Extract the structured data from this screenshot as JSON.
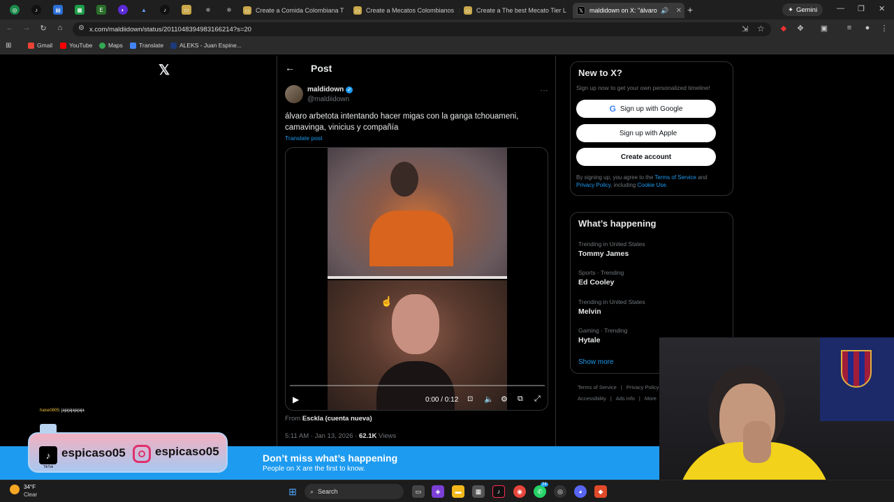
{
  "browser": {
    "tabs": [
      {
        "label": "Create a Comida Colombiana T"
      },
      {
        "label": "Create a Mecatos Colombianos"
      },
      {
        "label": "Create a The best Mecato Tier L"
      },
      {
        "label": "maldidown on X: \"álvaro ar"
      }
    ],
    "gemini_label": "Gemini",
    "url": "x.com/maldiidown/status/2011048394983166214?s=20",
    "bookmarks": [
      "Gmail",
      "YouTube",
      "Maps",
      "Translate",
      "ALEKS - Juan Espine..."
    ]
  },
  "header": {
    "title": "Post"
  },
  "post": {
    "display_name": "maldidown",
    "handle": "@maldiidown",
    "text_line1": "álvaro arbetota intentando hacer migas con la ganga tchouameni,",
    "text_line2": "camavinga,  vinicius y compañía",
    "translate_label": "Translate post",
    "from_prefix": "From",
    "from_source": "Esckla (cuenta nueva)",
    "timestamp": "5:11 AM · Jan 13, 2026 ·",
    "views_count": "62.1K",
    "views_label": "Views"
  },
  "video": {
    "time": "0:00 / 0:12",
    "progress": 0.0
  },
  "signup": {
    "title": "New to X?",
    "subtitle": "Sign up now to get your own personalized timeline!",
    "google_label": "Sign up with Google",
    "apple_label": "Sign up with Apple",
    "create_label": "Create account",
    "legal_prefix": "By signing up, you agree to the",
    "terms": "Terms of Service",
    "and": "and",
    "privacy": "Privacy Policy",
    "including": ", including",
    "cookie": "Cookie Use."
  },
  "trends": {
    "title": "What’s happening",
    "items": [
      {
        "meta": "Trending in United States",
        "name": "Tommy James"
      },
      {
        "meta": "Sports · Trending",
        "name": "Ed Cooley"
      },
      {
        "meta": "Trending in United States",
        "name": "Melvin"
      },
      {
        "meta": "Gaming · Trending",
        "name": "Hytale"
      }
    ],
    "show_more": "Show more"
  },
  "footer_links": {
    "row1": [
      "Terms of Service",
      "|",
      "Privacy Policy"
    ],
    "row2": [
      "Accessibility",
      "|",
      "Ads info",
      "|",
      "More"
    ]
  },
  "banner": {
    "title": "Don’t miss what’s happening",
    "subtitle": "People on X are the first to know."
  },
  "overlay": {
    "chat_user": "haise0805",
    "chat_msg": ": jajajajajajaja",
    "tiktok": "espicaso05",
    "instagram": "espicaso05",
    "tiktok_small": "TikTok"
  },
  "taskbar": {
    "temp": "34°F",
    "weather": "Clear",
    "search": "Search",
    "badge": "24"
  },
  "colors": {
    "accent": "#1d9bf0",
    "background": "#000000",
    "banner": "#1d9bf0"
  }
}
